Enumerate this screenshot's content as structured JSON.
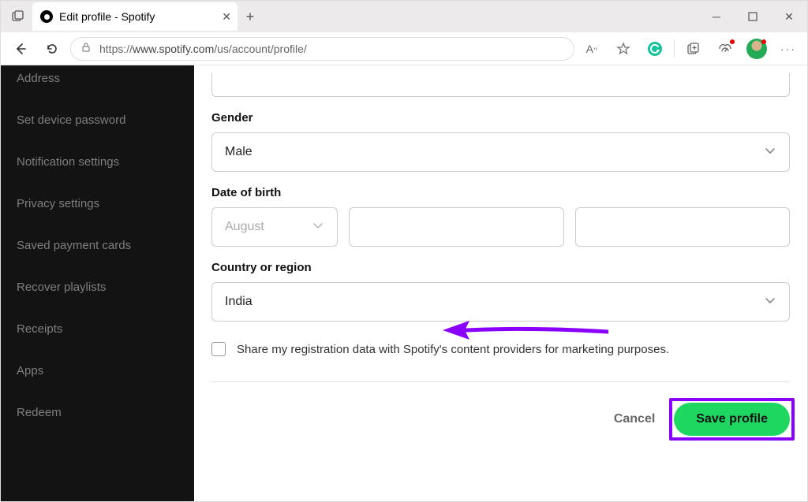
{
  "browser": {
    "tab_title": "Edit profile - Spotify",
    "url_prefix": "https://",
    "url_domain": "www.spotify.com",
    "url_path": "/us/account/profile/"
  },
  "sidebar": {
    "items": [
      {
        "label": "Address"
      },
      {
        "label": "Set device password"
      },
      {
        "label": "Notification settings"
      },
      {
        "label": "Privacy settings"
      },
      {
        "label": "Saved payment cards"
      },
      {
        "label": "Recover playlists"
      },
      {
        "label": "Receipts"
      },
      {
        "label": "Apps"
      },
      {
        "label": "Redeem"
      }
    ]
  },
  "form": {
    "gender_label": "Gender",
    "gender_value": "Male",
    "dob_label": "Date of birth",
    "dob_month": "August",
    "country_label": "Country or region",
    "country_value": "India",
    "share_label": "Share my registration data with Spotify's content providers for marketing purposes.",
    "cancel_label": "Cancel",
    "save_label": "Save profile"
  }
}
